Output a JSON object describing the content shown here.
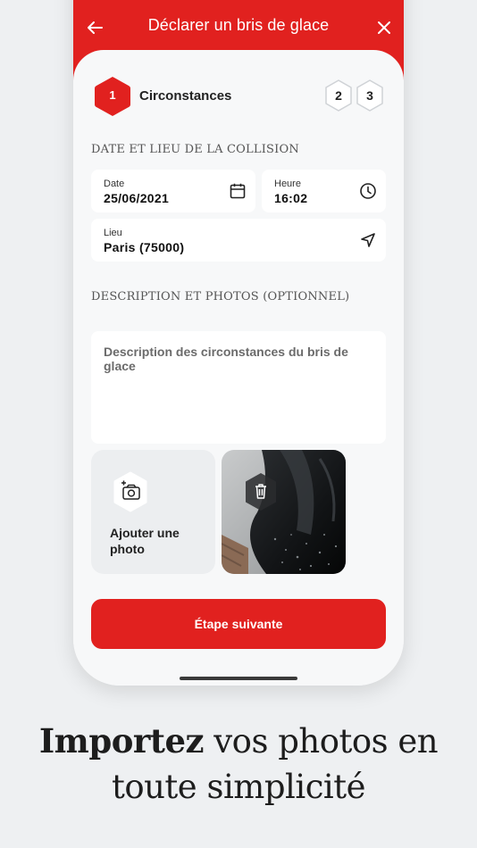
{
  "header": {
    "title": "Déclarer un bris de glace",
    "accent_color": "#e1211f",
    "back_icon": "arrow-left-icon",
    "close_icon": "close-icon"
  },
  "stepper": {
    "active_number": "1",
    "active_label": "Circonstances",
    "inactive": [
      "2",
      "3"
    ]
  },
  "section_date": {
    "title": "DATE ET LIEU DE LA COLLISION",
    "date": {
      "label": "Date",
      "value": "25/06/2021",
      "icon": "calendar-icon"
    },
    "time": {
      "label": "Heure",
      "value": "16:02",
      "icon": "clock-icon"
    },
    "place": {
      "label": "Lieu",
      "value": "Paris (75000)",
      "icon": "navigation-icon"
    }
  },
  "section_desc": {
    "title": "DESCRIPTION ET PHOTOS (OPTIONNEL)",
    "placeholder": "Description des circonstances du bris de glace",
    "add_photo_label": "Ajouter une photo",
    "add_photo_icon": "camera-add-icon",
    "delete_icon": "trash-icon"
  },
  "actions": {
    "next_label": "Étape suivante"
  },
  "tagline": {
    "bold": "Importez",
    "rest_line1": " vos photos en",
    "line2": "toute simplicité"
  }
}
